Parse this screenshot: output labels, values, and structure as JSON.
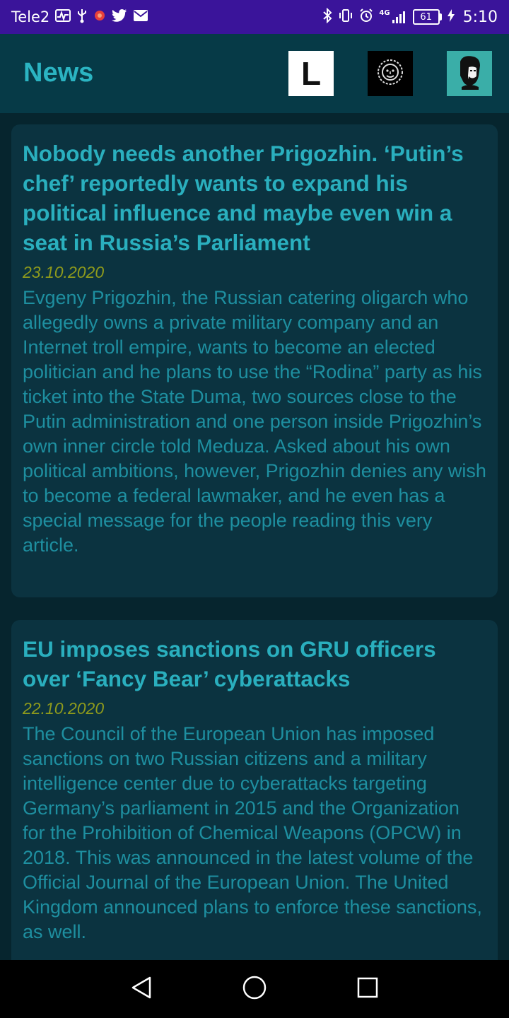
{
  "status_bar": {
    "carrier": "Tele2",
    "network": "4G",
    "battery": "61",
    "time": "5:10",
    "left_icons": [
      "activity-icon",
      "usb-icon",
      "notification-dot-icon",
      "twitter-icon",
      "mail-icon"
    ],
    "right_icons": [
      "bluetooth-icon",
      "vibrate-icon",
      "alarm-icon",
      "signal-icon",
      "battery-icon",
      "charging-icon"
    ]
  },
  "app_bar": {
    "title": "News",
    "sources": [
      {
        "name": "source-l-button",
        "label": "L"
      },
      {
        "name": "source-meduza-button",
        "icon": "lion-icon"
      },
      {
        "name": "source-portrait-button",
        "icon": "portrait-icon"
      }
    ]
  },
  "articles": [
    {
      "title": "Nobody needs another Prigozhin. ‘Putin’s chef’ reportedly wants to expand his political influence and maybe even win a seat in Russia’s Parliament",
      "date": "23.10.2020",
      "summary": "Evgeny Prigozhin, the Russian catering oligarch who allegedly owns a private military company and an Internet troll empire, wants to become an elected politician and he plans to use the “Rodina” party as his ticket into the State Duma, two sources close to the Putin administration and one person inside Prigozhin’s own inner circle told Meduza. Asked about his own political ambitions, however, Prigozhin denies any wish to become a federal lawmaker, and he even has a special message for the people reading this very article."
    },
    {
      "title": "EU imposes sanctions on GRU officers over ‘Fancy Bear’ cyberattacks",
      "date": "22.10.2020",
      "summary": "The Council of the European Union has imposed sanctions on two Russian citizens and a military intelligence center due to cyberattacks targeting Germany’s parliament in 2015 and the Organization for the Prohibition of Chemical Weapons (OPCW) in 2018. This was announced in the latest volume of the Official Journal of the European Union. The United Kingdom announced plans to enforce these sanctions, as well."
    }
  ],
  "nav_bar": {
    "buttons": [
      "back-button",
      "home-button",
      "recents-button"
    ]
  },
  "colors": {
    "status_bar": "#3a149a",
    "app_bar": "#063a47",
    "background": "#06252e",
    "card": "#0b3340",
    "title": "#2aafbe",
    "date": "#8e9a1c",
    "body": "#1e8fa0"
  }
}
